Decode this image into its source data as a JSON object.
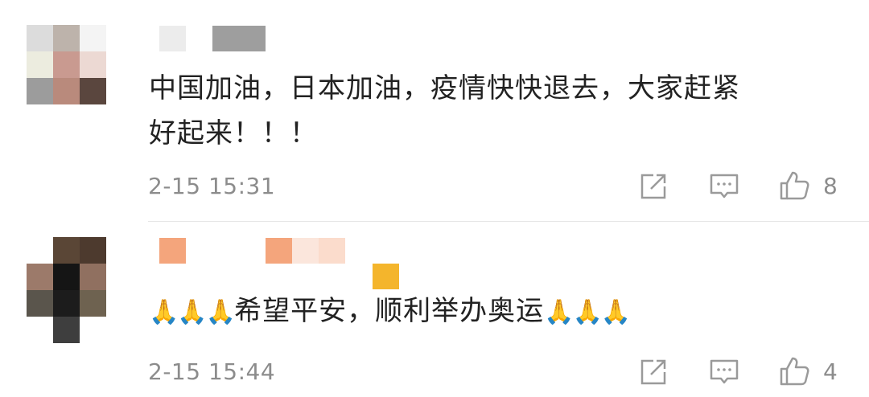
{
  "comments": [
    {
      "text_line1": "中国加油，日本加油，疫情快快退去，大家赶紧",
      "text_line2": "好起来！！！",
      "time": "2-15 15:31",
      "likes": "8"
    },
    {
      "text": "希望平安，顺利举办奥运",
      "emoji": "🙏",
      "time": "2-15 15:44",
      "likes": "4"
    }
  ],
  "icons": {
    "share": "share-icon",
    "reply": "comment-icon",
    "like": "thumbs-up-icon"
  },
  "colors": {
    "timestamp": "#8c8c8c",
    "text": "#222222",
    "divider": "#e6e6e6"
  }
}
